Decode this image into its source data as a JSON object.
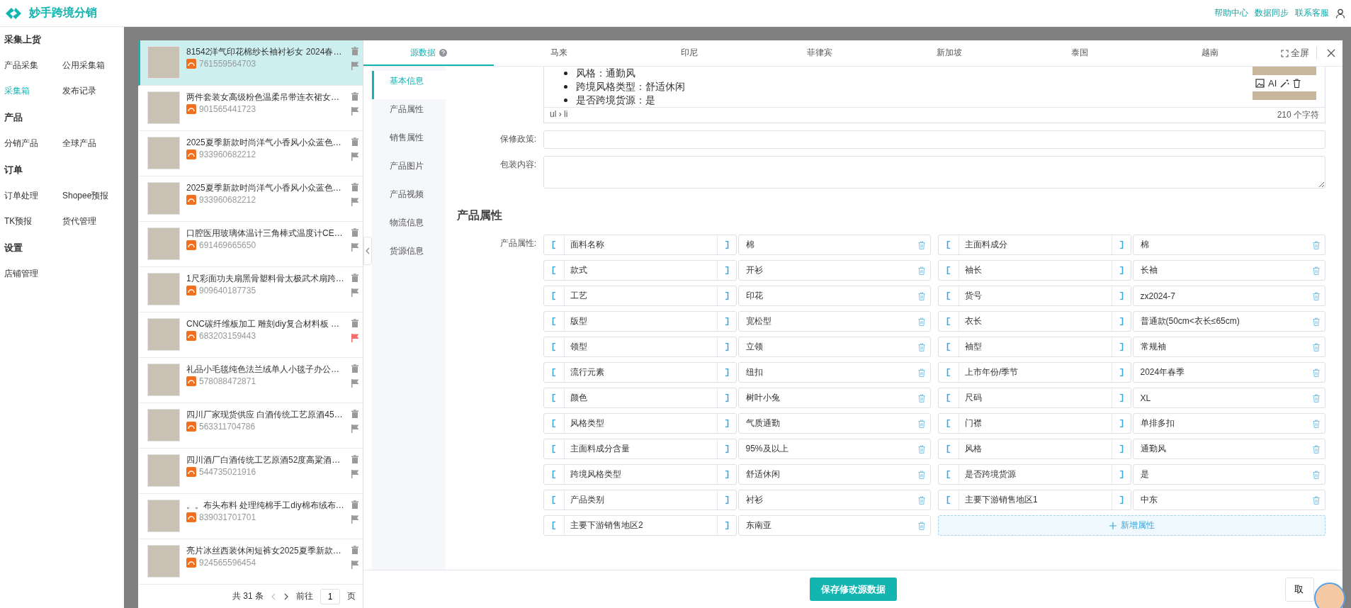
{
  "header": {
    "brand": "妙手跨境分销",
    "links": [
      "帮助中心",
      "数据同步",
      "联系客服"
    ]
  },
  "sidebar": {
    "sections": [
      {
        "title": "采集上货",
        "items": [
          {
            "label": "产品采集",
            "selected": false
          },
          {
            "label": "公用采集箱",
            "selected": false
          },
          {
            "label": "采集箱",
            "selected": true
          },
          {
            "label": "发布记录",
            "selected": false
          }
        ]
      },
      {
        "title": "产品",
        "items": [
          {
            "label": "分销产品",
            "selected": false
          },
          {
            "label": "全球产品",
            "selected": false
          }
        ]
      },
      {
        "title": "订单",
        "items": [
          {
            "label": "订单处理",
            "selected": false
          },
          {
            "label": "Shopee预报",
            "selected": false
          },
          {
            "label": "TK预报",
            "selected": false
          },
          {
            "label": "货代管理",
            "selected": false
          }
        ]
      },
      {
        "title": "设置",
        "items": [
          {
            "label": "店铺管理",
            "selected": false
          }
        ]
      }
    ]
  },
  "product_list": {
    "items": [
      {
        "title": "81542洋气印花棉纱长袖衬衫女 2024春…",
        "id": "761559564703",
        "selected": true,
        "flagged": false
      },
      {
        "title": "两件套装女高级粉色温柔吊带连衣裙女…",
        "id": "901565441723",
        "selected": false,
        "flagged": false
      },
      {
        "title": "2025夏季新款时尚洋气小香风小众蓝色…",
        "id": "933960682212",
        "selected": false,
        "flagged": false
      },
      {
        "title": "2025夏季新款时尚洋气小香风小众蓝色…",
        "id": "933960682212",
        "selected": false,
        "flagged": false
      },
      {
        "title": "口腔医用玻璃体温计三角棒式温度计CE…",
        "id": "691469665650",
        "selected": false,
        "flagged": false
      },
      {
        "title": "1尺彩面功夫扇黑骨塑料骨太极武术扇跨…",
        "id": "909640187735",
        "selected": false,
        "flagged": false
      },
      {
        "title": "CNC碳纤维板加工 雕刻diy复合材料板 …",
        "id": "683203159443",
        "selected": false,
        "flagged": true
      },
      {
        "title": "礼品小毛毯纯色法兰绒单人小毯子办公…",
        "id": "578088472871",
        "selected": false,
        "flagged": false
      },
      {
        "title": "四川厂家现货供应 白酒传统工艺原酒45…",
        "id": "563311704786",
        "selected": false,
        "flagged": false
      },
      {
        "title": "四川酒厂白酒传统工艺原酒52度高粱酒…",
        "id": "544735021916",
        "selected": false,
        "flagged": false
      },
      {
        "title": "。。布头布料 处理纯棉手工diy棉布绒布…",
        "id": "839031701701",
        "selected": false,
        "flagged": false
      },
      {
        "title": "亮片冰丝西装休闲短裤女2025夏季新款…",
        "id": "924565596454",
        "selected": false,
        "flagged": false
      }
    ],
    "pagination": {
      "total": "共 31 条",
      "goto": "前往",
      "page": "1",
      "suffix": "页"
    }
  },
  "tabs": [
    {
      "label": "源数据",
      "selected": true,
      "help": true
    },
    {
      "label": "马来",
      "selected": false,
      "help": false
    },
    {
      "label": "印尼",
      "selected": false,
      "help": false
    },
    {
      "label": "菲律宾",
      "selected": false,
      "help": false
    },
    {
      "label": "新加坡",
      "selected": false,
      "help": false
    },
    {
      "label": "泰国",
      "selected": false,
      "help": false
    },
    {
      "label": "越南",
      "selected": false,
      "help": false
    }
  ],
  "fullscreen": "全屏",
  "nav": [
    {
      "label": "基本信息",
      "selected": true
    },
    {
      "label": "产品属性",
      "selected": false
    },
    {
      "label": "销售属性",
      "selected": false
    },
    {
      "label": "产品图片",
      "selected": false
    },
    {
      "label": "产品视频",
      "selected": false
    },
    {
      "label": "物流信息",
      "selected": false
    },
    {
      "label": "货源信息",
      "selected": false
    }
  ],
  "editor": {
    "bullets": [
      "风格：通勤风",
      "跨境风格类型：舒适休闲",
      "是否跨境货源：是"
    ],
    "path": "ul › li",
    "char_count": "210 个字符",
    "ai": "AI"
  },
  "fields": [
    {
      "label": "保修政策:",
      "kind": "input"
    },
    {
      "label": "包装内容:",
      "kind": "textarea"
    }
  ],
  "attributes": {
    "section_title": "产品属性",
    "label": "产品属性:",
    "items": [
      {
        "name": "面料名称",
        "value": "棉"
      },
      {
        "name": "主面料成分",
        "value": "棉"
      },
      {
        "name": "款式",
        "value": "开衫"
      },
      {
        "name": "袖长",
        "value": "长袖"
      },
      {
        "name": "工艺",
        "value": "印花"
      },
      {
        "name": "货号",
        "value": "zx2024-7"
      },
      {
        "name": "版型",
        "value": "宽松型"
      },
      {
        "name": "衣长",
        "value": "普通款(50cm<衣长≤65cm)"
      },
      {
        "name": "领型",
        "value": "立领"
      },
      {
        "name": "袖型",
        "value": "常规袖"
      },
      {
        "name": "流行元素",
        "value": "纽扣"
      },
      {
        "name": "上市年份/季节",
        "value": "2024年春季"
      },
      {
        "name": "颜色",
        "value": "树叶小兔"
      },
      {
        "name": "尺码",
        "value": "XL"
      },
      {
        "name": "风格类型",
        "value": "气质通勤"
      },
      {
        "name": "门襟",
        "value": "单排多扣"
      },
      {
        "name": "主面料成分含量",
        "value": "95%及以上"
      },
      {
        "name": "风格",
        "value": "通勤风"
      },
      {
        "name": "跨境风格类型",
        "value": "舒适休闲"
      },
      {
        "name": "是否跨境货源",
        "value": "是"
      },
      {
        "name": "产品类别",
        "value": "衬衫"
      },
      {
        "name": "主要下游销售地区1",
        "value": "中东"
      },
      {
        "name": "主要下游销售地区2",
        "value": "东南亚"
      }
    ],
    "add_button": "新增属性"
  },
  "footer": {
    "save": "保存修改源数据",
    "cancel": "取"
  }
}
